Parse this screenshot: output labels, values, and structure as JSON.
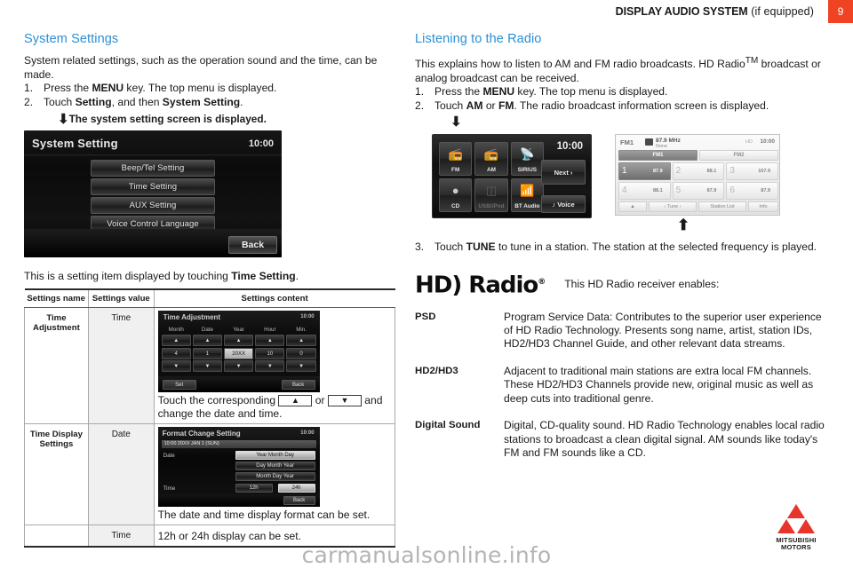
{
  "header": {
    "title_bold": "DISPLAY AUDIO SYSTEM",
    "title_rest": " (if equipped)",
    "page_number": "9",
    "accent_color": "#f04323"
  },
  "left_column": {
    "section_title": "System Settings",
    "intro": "System related settings, such as the operation sound and the time, can be made.",
    "steps": [
      {
        "num": "1.",
        "pre": "Press the ",
        "bold": "MENU",
        "post": " key. The top menu is displayed."
      },
      {
        "num": "2.",
        "pre": "Touch ",
        "bold": "Setting",
        "mid": ", and then ",
        "bold2": "System Setting",
        "post": "."
      }
    ],
    "arrow_caption": "The system setting screen is displayed.",
    "system_setting_screen": {
      "title": "System Setting",
      "clock": "10:00",
      "buttons": [
        "Beep/Tel Setting",
        "Time Setting",
        "AUX Setting",
        "Voice Control Language"
      ],
      "back_label": "Back"
    },
    "table_intro_pre": "This is a setting item displayed by touching ",
    "table_intro_bold": "Time Setting",
    "table_intro_post": ".",
    "table": {
      "headers": [
        "Settings name",
        "Settings value",
        "Settings content"
      ],
      "rows": [
        {
          "name": "Time Adjustment",
          "value": "Time",
          "screen": {
            "title": "Time Adjustment",
            "clock": "10:00",
            "columns": [
              "Month",
              "Date",
              "Year",
              "Hour",
              "Min."
            ],
            "values": [
              "4",
              "1",
              "20XX",
              "10",
              "0"
            ],
            "selected_index": 2,
            "set_label": "Set",
            "back_label": "Back"
          },
          "caption_pre": "Touch the corresponding ",
          "caption_key_up": "▲",
          "caption_mid": " or ",
          "caption_key_down": "▼",
          "caption_post": " and change the date and time."
        },
        {
          "name": "Time Display Settings",
          "value": "Date",
          "screen": {
            "title": "Format Change Setting",
            "clock": "10:00",
            "strip": "10:00  20XX JAN 1  (SUN)",
            "date_label": "Date",
            "date_options": [
              "Year Month Day",
              "Day Month Year",
              "Month Day Year"
            ],
            "date_selected_index": 0,
            "time_label": "Time",
            "time_options": [
              "12h",
              "24h"
            ],
            "time_selected_index": 1,
            "back_label": "Back"
          },
          "caption": "The date and time display format can be set."
        },
        {
          "name": "",
          "value": "Time",
          "caption": "12h or 24h display can be set."
        }
      ]
    }
  },
  "right_column": {
    "section_title": "Listening to the Radio",
    "intro_a": "This explains how to listen to AM and FM radio broadcasts. HD Radio",
    "intro_tm": "TM",
    "intro_b": " broadcast or analog broadcast can be received.",
    "steps": [
      {
        "num": "1.",
        "pre": "Press the ",
        "bold": "MENU",
        "post": " key. The top menu is displayed."
      },
      {
        "num": "2.",
        "pre": "Touch ",
        "bold": "AM",
        "mid": " or ",
        "bold2": "FM",
        "post": ". The radio broadcast information screen is displayed."
      }
    ],
    "top_menu_screen": {
      "clock": "10:00",
      "tiles": [
        {
          "label": "FM",
          "icon": "radio-icon",
          "dim": false
        },
        {
          "label": "AM",
          "icon": "radio-icon",
          "dim": false
        },
        {
          "label": "SIRIUS",
          "icon": "satellite-icon",
          "dim": false
        },
        {
          "label": "CD",
          "icon": "disc-icon",
          "dim": false
        },
        {
          "label": "USB/iPod",
          "icon": "usb-icon",
          "dim": true
        },
        {
          "label": "BT Audio",
          "icon": "bluetooth-icon",
          "dim": false
        }
      ],
      "next_label": "Next",
      "voice_label": "Voice"
    },
    "fm_screen": {
      "band": "FM1",
      "frequency": "87.9 MHz",
      "station_name": "None",
      "clock": "10:00",
      "sub_indicator": "HD",
      "tabs": [
        "FM1",
        "FM2"
      ],
      "active_tab_index": 0,
      "presets": [
        {
          "n": "1",
          "f": "87.9"
        },
        {
          "n": "2",
          "f": "88.1"
        },
        {
          "n": "3",
          "f": "107.9"
        },
        {
          "n": "4",
          "f": "88.1"
        },
        {
          "n": "5",
          "f": "87.9"
        },
        {
          "n": "6",
          "f": "87.9"
        }
      ],
      "selected_preset_index": 0,
      "bottom_buttons": [
        "▲",
        "‹  Tune  ›",
        "Station List",
        "Info"
      ]
    },
    "step3": {
      "num": "3.",
      "pre": "Touch ",
      "bold": "TUNE",
      "post": " to tune in a station. The station at the selected frequency is played."
    },
    "hd_logo_text": "HD)",
    "hd_logo_word": "Radio",
    "hd_logo_reg": "®",
    "hd_caption": "This HD Radio receiver enables:",
    "definitions": [
      {
        "term": "PSD",
        "desc": "Program Service Data: Contributes to the superior user experience of HD Radio Technology. Presents song name, artist, station IDs, HD2/HD3 Channel Guide, and other relevant data streams."
      },
      {
        "term": "HD2/HD3",
        "desc": "Adjacent to traditional main stations are extra local FM channels. These HD2/HD3 Channels provide new, original music as well as deep cuts into traditional genre."
      },
      {
        "term": "Digital Sound",
        "desc": "Digital, CD-quality sound. HD Radio Technology enables local radio stations to broadcast a clean digital signal. AM sounds like today's FM and FM sounds like a CD."
      }
    ]
  },
  "footer": {
    "brand_line1": "MITSUBISHI",
    "brand_line2": "MOTORS",
    "brand_color": "#e8342a",
    "watermark": "carmanualsonline.info"
  }
}
